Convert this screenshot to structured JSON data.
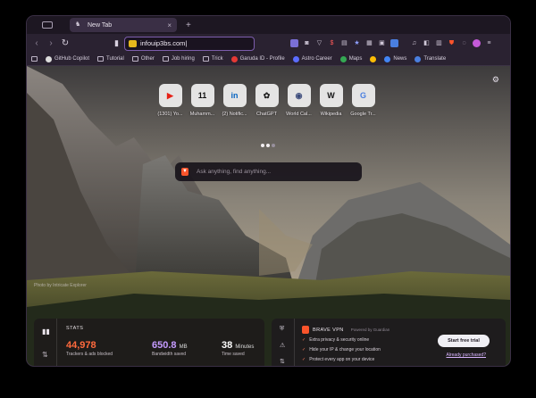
{
  "tab": {
    "title": "New Tab",
    "close": "×",
    "new": "+"
  },
  "toolbar": {
    "url": "infouip3bs.com|"
  },
  "bookmarks": [
    {
      "label": "GitHub Copilot",
      "icon": "github-icon"
    },
    {
      "label": "Tutorial",
      "icon": "folder-icon"
    },
    {
      "label": "Other",
      "icon": "folder-icon"
    },
    {
      "label": "Job hiring",
      "icon": "folder-icon"
    },
    {
      "label": "Trick",
      "icon": "folder-icon"
    },
    {
      "label": "Garuda ID - Profile",
      "icon": "garuda-icon"
    },
    {
      "label": "Astro Career",
      "icon": "astro-icon"
    },
    {
      "label": "Maps",
      "icon": "maps-icon"
    },
    {
      "label": "News",
      "icon": "news-icon"
    },
    {
      "label": "Translate",
      "icon": "translate-icon"
    }
  ],
  "tiles": [
    {
      "label": "(1301) Yo...",
      "icon": "youtube-icon",
      "glyph": "▶",
      "color": "#e62117"
    },
    {
      "label": "Muhamm...",
      "icon": "eleven-icon",
      "glyph": "11",
      "color": "#111111"
    },
    {
      "label": "(2) Notific...",
      "icon": "linkedin-icon",
      "glyph": "in",
      "color": "#0a66c2"
    },
    {
      "label": "ChatGPT",
      "icon": "chatgpt-icon",
      "glyph": "✿",
      "color": "#222222"
    },
    {
      "label": "World Cal...",
      "icon": "world-icon",
      "glyph": "◉",
      "color": "#3b4a7a"
    },
    {
      "label": "Wikipedia",
      "icon": "wikipedia-icon",
      "glyph": "W",
      "color": "#111111"
    },
    {
      "label": "Google Tr...",
      "icon": "translate-icon",
      "glyph": "G",
      "color": "#4a7fe0"
    }
  ],
  "search": {
    "placeholder": "Ask anything, find anything..."
  },
  "photo_credit": "Photo by Intricate Explorer",
  "stats": {
    "title": "STATS",
    "trackers": {
      "value": "44,978",
      "caption": "Trackers & ads blocked",
      "color": "#ff6a3d"
    },
    "bandwidth": {
      "value": "650.8",
      "unit": "MB",
      "caption": "Bandwidth saved",
      "color": "#c59bff"
    },
    "time": {
      "value": "38",
      "unit": "Minutes",
      "caption": "Time saved",
      "color": "#ffffff"
    }
  },
  "vpn": {
    "name": "BRAVE VPN",
    "powered": "Powered by Guardian",
    "features": [
      "Extra privacy & security online",
      "Hide your IP & change your location",
      "Protect every app on your device"
    ],
    "trial_label": "Start free trial",
    "already_label": "Already purchased?"
  }
}
